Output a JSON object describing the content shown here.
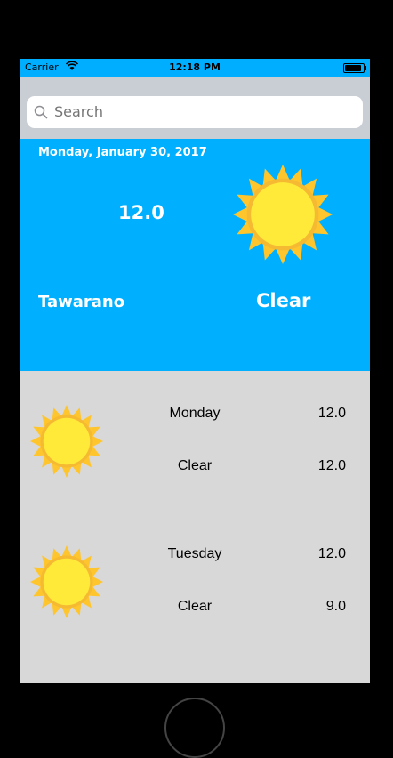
{
  "status_bar": {
    "carrier": "Carrier",
    "time": "12:18 PM",
    "battery_level": 0.9
  },
  "search": {
    "placeholder": "Search"
  },
  "current": {
    "date": "Monday, January 30, 2017",
    "temperature": "12.0",
    "city": "Tawarano",
    "condition": "Clear",
    "icon": "sun-icon"
  },
  "forecast": [
    {
      "day": "Monday",
      "condition": "Clear",
      "high": "12.0",
      "low": "12.0",
      "icon": "sun-icon"
    },
    {
      "day": "Tuesday",
      "condition": "Clear",
      "high": "12.0",
      "low": "9.0",
      "icon": "sun-icon"
    }
  ],
  "colors": {
    "header_blue": "#00b0ff",
    "sun_yellow": "#ffe433",
    "sun_orange": "#ffc52c",
    "list_bg": "#d8d8d8"
  }
}
